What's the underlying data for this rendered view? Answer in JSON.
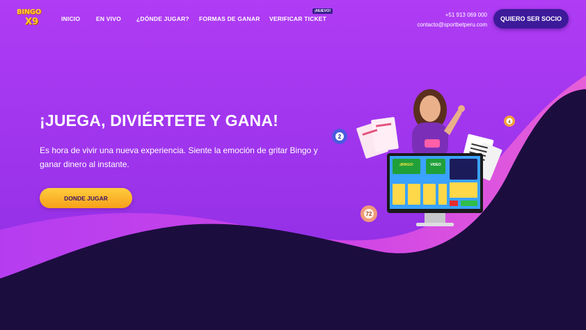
{
  "logo": {
    "top": "BINGO",
    "bottom": "X9"
  },
  "nav": {
    "items": [
      {
        "label": "INICIO"
      },
      {
        "label": "EN VIVO"
      },
      {
        "label": "¿DÓNDE JUGAR?"
      },
      {
        "label": "FORMAS DE GANAR"
      },
      {
        "label": "VERIFICAR TICKET"
      }
    ],
    "new_badge": "¡NUEVO!"
  },
  "contact": {
    "phone": "+51 913 069 000",
    "email": "contacto@sportbetperu.com"
  },
  "cta_partner": "QUIERO SER SOCIO",
  "hero": {
    "headline": "¡JUEGA, DIVIÉRTETE Y GANA!",
    "subtext": "Es hora de vivir una nueva experiencia. Siente la emoción de gritar Bingo y ganar dinero al instante.",
    "cta": "DONDE JUGAR"
  },
  "illustration": {
    "balls": [
      "2",
      "72",
      "4"
    ],
    "screen_labels": [
      "¡BINGO!",
      "VIDEO"
    ]
  },
  "colors": {
    "background": "#a235f0",
    "wave_dark": "#1c0d3f",
    "wave_pink": "#d14ce6",
    "partner_button": "#3c1a9a",
    "play_button": "#f7a01a"
  }
}
